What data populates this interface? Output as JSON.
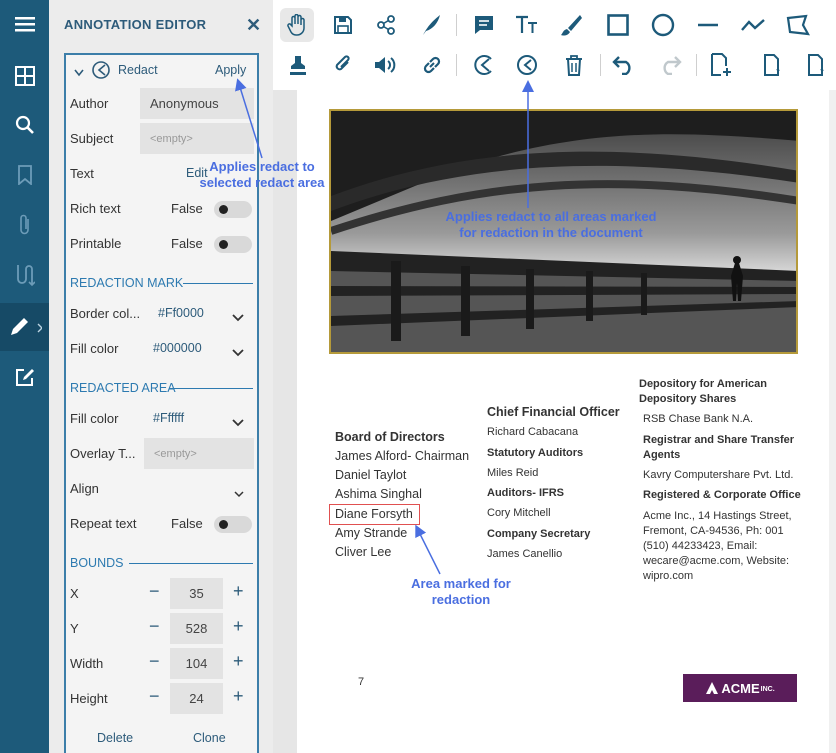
{
  "editor": {
    "title": "ANNOTATION EDITOR",
    "annotation": {
      "label": "Redact",
      "apply": "Apply"
    },
    "rows": {
      "author": {
        "label": "Author",
        "value": "Anonymous"
      },
      "subject": {
        "label": "Subject",
        "placeholder": "<empty>"
      },
      "text": {
        "label": "Text",
        "action": "Edit"
      },
      "rich_text": {
        "label": "Rich text",
        "value": "False"
      },
      "printable": {
        "label": "Printable",
        "value": "False"
      }
    },
    "redaction_mark": {
      "header": "REDACTION MARK",
      "border_color": {
        "label": "Border col...",
        "value": "#Ff0000"
      },
      "fill_color": {
        "label": "Fill color",
        "value": "#000000"
      }
    },
    "redacted_area": {
      "header": "REDACTED AREA",
      "fill_color": {
        "label": "Fill color",
        "value": "#Ffffff"
      },
      "overlay_text": {
        "label": "Overlay T...",
        "placeholder": "<empty>"
      },
      "align": {
        "label": "Align"
      },
      "repeat_text": {
        "label": "Repeat text",
        "value": "False"
      }
    },
    "bounds": {
      "header": "BOUNDS",
      "x": {
        "label": "X",
        "value": "35"
      },
      "y": {
        "label": "Y",
        "value": "528"
      },
      "width": {
        "label": "Width",
        "value": "104"
      },
      "height": {
        "label": "Height",
        "value": "24"
      }
    },
    "footer": {
      "delete": "Delete",
      "clone": "Clone"
    }
  },
  "callouts": {
    "apply": "Applies redact to\nselected redact area",
    "apply_all": "Applies redact to all areas marked\nfor redaction in the document",
    "area": "Area marked for\nredaction"
  },
  "document": {
    "board": {
      "heading": "Board of Directors",
      "members": [
        "James Alford- Chairman",
        "Daniel Taylot",
        "Ashima Singhal",
        "Diane Forsyth",
        "Amy Strande",
        "Cliver Lee"
      ]
    },
    "cfo": {
      "heading": "Chief Financial Officer",
      "name": "Richard Cabacana",
      "statutory_heading": "Statutory Auditors",
      "statutory_name": "Miles Reid",
      "ifrs_heading": "Auditors- IFRS",
      "ifrs_name": "Cory Mitchell",
      "secretary_heading": "Company Secretary",
      "secretary_name": "James Canellio"
    },
    "depository": {
      "heading1": "Depository for American",
      "heading2": "Depository Shares",
      "bank": "RSB Chase Bank N.A.",
      "registrar_h1": "Registrar and Share Transfer",
      "registrar_h2": "Agents",
      "registrar": "Kavry Computershare Pvt. Ltd.",
      "office_heading": "Registered & Corporate Office",
      "address1": "Acme Inc., 14 Hastings Street,",
      "address2": "Fremont, CA-94536, Ph: 001",
      "address3": "(510) 44233423, Email:",
      "address4": "wecare@acme.com, Website:",
      "address5": "wipro.com"
    },
    "page_number": "7",
    "logo_text": "ACME",
    "logo_suffix": "INC."
  },
  "colors": {
    "accent": "#2d7ab0",
    "nav": "#1d5a7a",
    "callout": "#4a6ee0",
    "redact_border": "#e05050"
  }
}
